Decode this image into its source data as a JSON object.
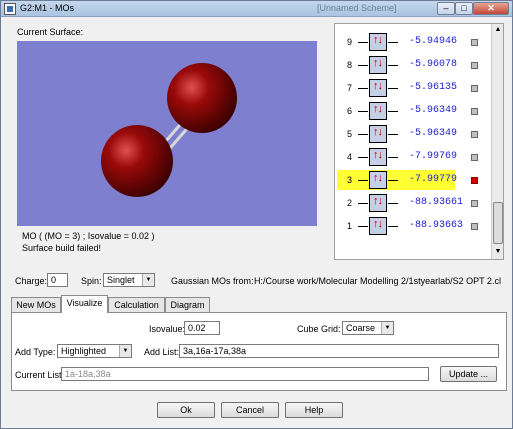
{
  "window": {
    "title": "G2:M1 - MOs",
    "faded_title": "[Unnamed Scheme]"
  },
  "surface": {
    "label": "Current Surface:",
    "mo_info": "MO ( (MO = 3) ; Isovalue = 0.02 )",
    "status": "Surface build failed!"
  },
  "diagram": {
    "levels": [
      {
        "num": "9",
        "arrows": "↑↓",
        "energy": "-5.94946",
        "selected": false
      },
      {
        "num": "8",
        "arrows": "↑↓",
        "energy": "-5.96078",
        "selected": false
      },
      {
        "num": "7",
        "arrows": "↑↓",
        "energy": "-5.96135",
        "selected": false
      },
      {
        "num": "6",
        "arrows": "↑↓",
        "energy": "-5.96349",
        "selected": false
      },
      {
        "num": "5",
        "arrows": "↑↓",
        "energy": "-5.96349",
        "selected": false
      },
      {
        "num": "4",
        "arrows": "↑↓",
        "energy": "-7.99769",
        "selected": false
      },
      {
        "num": "3",
        "arrows": "↑↓",
        "energy": "-7.99779",
        "selected": true
      },
      {
        "num": "2",
        "arrows": "↑↓",
        "energy": "-88.93661",
        "selected": false
      },
      {
        "num": "1",
        "arrows": "↑↓",
        "energy": "-88.93663",
        "selected": false
      }
    ],
    "highlight_color": "#ffff33",
    "selected_square_color": "#d00000"
  },
  "charge": {
    "label": "Charge:",
    "value": "0"
  },
  "spin": {
    "label": "Spin:",
    "value": "Singlet"
  },
  "gaussian": {
    "label": "Gaussian MOs from:",
    "path": "H:/Course work/Molecular Modelling 2/1styearlab/S2 OPT 2.cl"
  },
  "tabs": [
    {
      "label": "New MOs"
    },
    {
      "label": "Visualize"
    },
    {
      "label": "Calculation"
    },
    {
      "label": "Diagram"
    }
  ],
  "visualize": {
    "isovalue_label": "Isovalue:",
    "isovalue": "0.02",
    "cube_grid_label": "Cube Grid:",
    "cube_grid": "Coarse",
    "add_type_label": "Add Type:",
    "add_type": "Highlighted",
    "add_list_label": "Add List:",
    "add_list": "3a,16a-17a,38a",
    "current_list_label": "Current List:",
    "current_list": "1a-18a,38a",
    "update_label": "Update ..."
  },
  "buttons": {
    "ok": "Ok",
    "cancel": "Cancel",
    "help": "Help"
  },
  "colors": {
    "viewport_bg": "#7f7fd0",
    "atom": "#8b0000",
    "energy_text": "#2020d0"
  }
}
